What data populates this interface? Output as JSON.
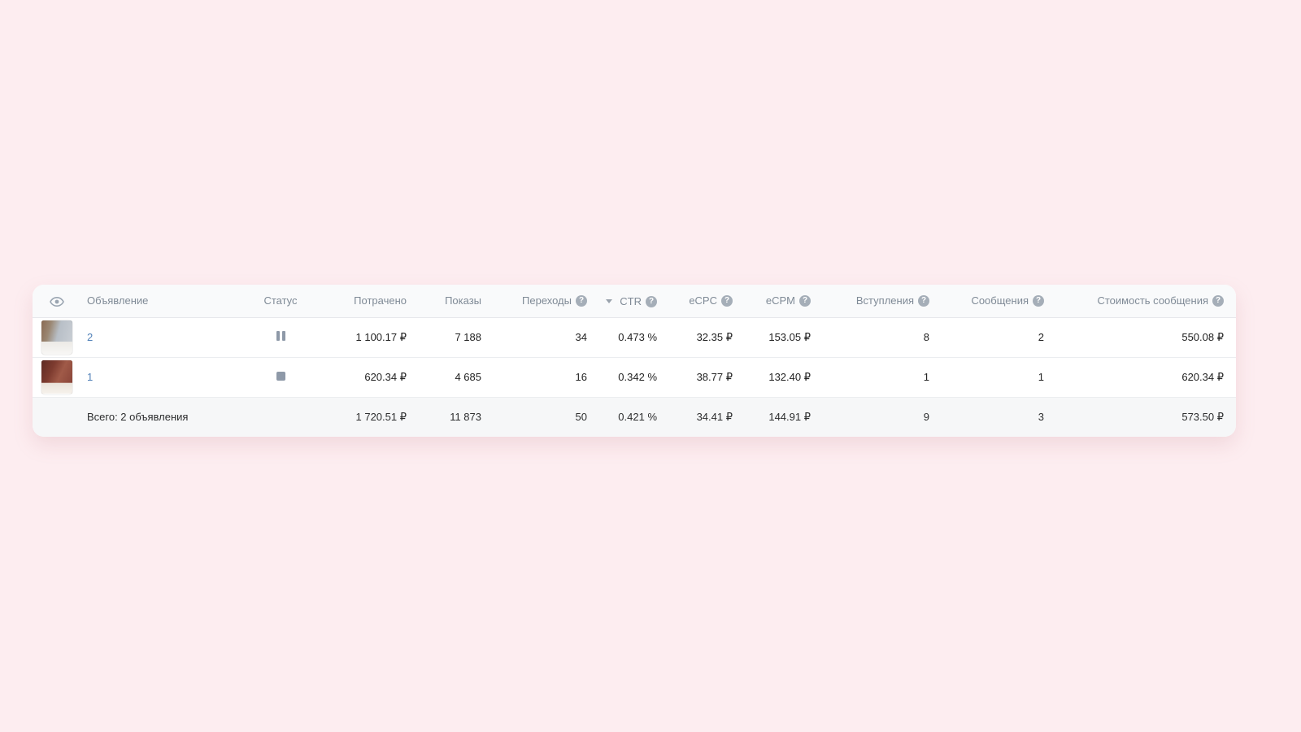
{
  "page": {
    "background_color": "#fdedf0",
    "card_color": "#ffffff",
    "accent_link_color": "#5181b8",
    "status_icon_color": "#8e99a8"
  },
  "table": {
    "columns": {
      "visibility": {
        "label": "",
        "icon": "eye-icon"
      },
      "ad": {
        "label": "Объявление"
      },
      "status": {
        "label": "Статус"
      },
      "spent": {
        "label": "Потрачено"
      },
      "shows": {
        "label": "Показы"
      },
      "clicks": {
        "label": "Переходы",
        "help": true
      },
      "ctr": {
        "label": "CTR",
        "help": true,
        "sorted": "desc"
      },
      "ecpc": {
        "label": "eCPC",
        "help": true
      },
      "ecpm": {
        "label": "eCPM",
        "help": true
      },
      "joins": {
        "label": "Вступления",
        "help": true
      },
      "messages": {
        "label": "Сообщения",
        "help": true
      },
      "msg_cost": {
        "label": "Стоимость сообщения",
        "help": true
      }
    },
    "help_glyph": "?",
    "rows": [
      {
        "ad": "2",
        "status": "paused",
        "spent": "1 100.17 ₽",
        "shows": "7 188",
        "clicks": "34",
        "ctr": "0.473 %",
        "ecpc": "32.35 ₽",
        "ecpm": "153.05 ₽",
        "joins": "8",
        "messages": "2",
        "msg_cost": "550.08 ₽"
      },
      {
        "ad": "1",
        "status": "stopped",
        "spent": "620.34 ₽",
        "shows": "4 685",
        "clicks": "16",
        "ctr": "0.342 %",
        "ecpc": "38.77 ₽",
        "ecpm": "132.40 ₽",
        "joins": "1",
        "messages": "1",
        "msg_cost": "620.34 ₽"
      }
    ],
    "total": {
      "label": "Всего: 2 объявления",
      "spent": "1 720.51 ₽",
      "shows": "11 873",
      "clicks": "50",
      "ctr": "0.421 %",
      "ecpc": "34.41 ₽",
      "ecpm": "144.91 ₽",
      "joins": "9",
      "messages": "3",
      "msg_cost": "573.50 ₽"
    }
  }
}
